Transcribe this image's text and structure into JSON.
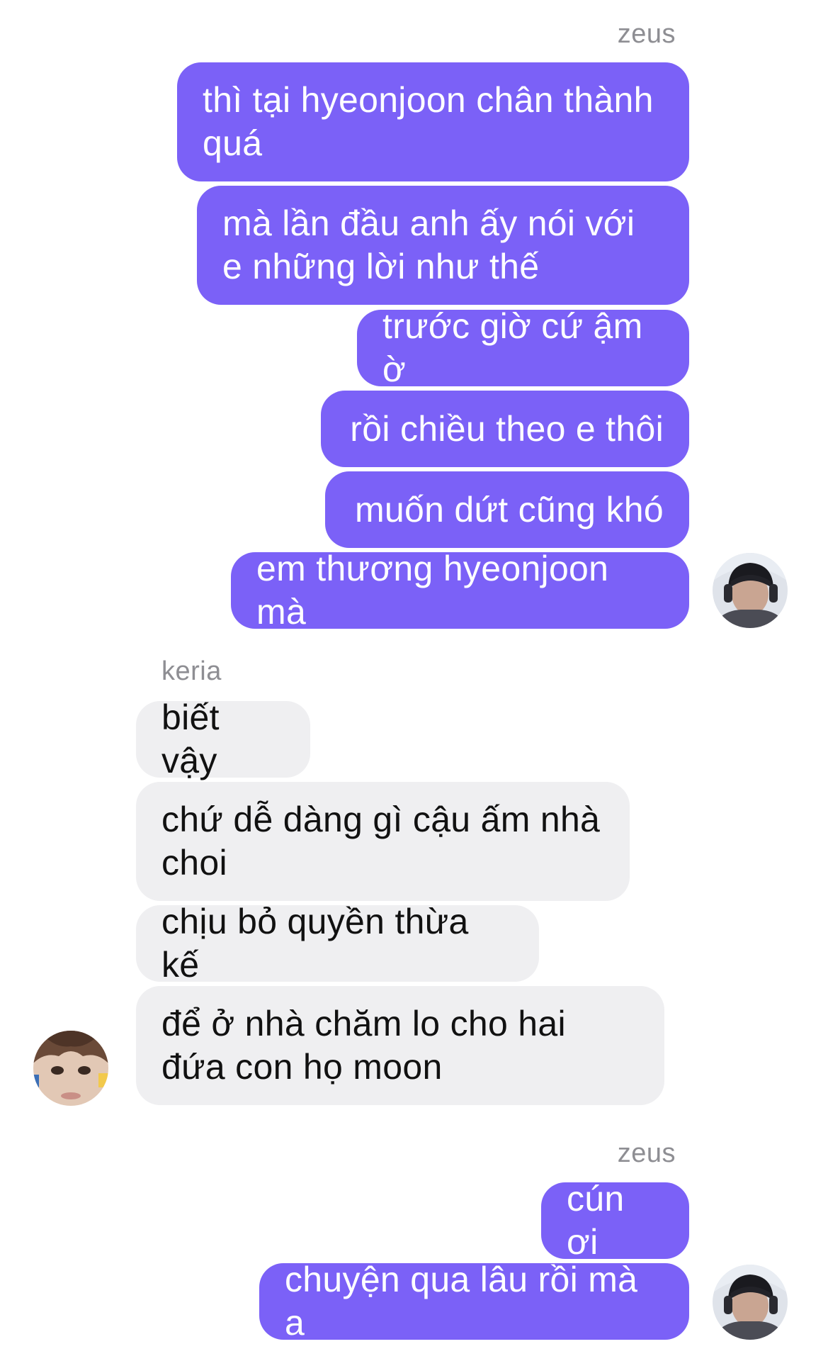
{
  "chat": {
    "group1": {
      "sender": "zeus",
      "messages": [
        "thì tại hyeonjoon chân thành quá",
        "mà lần đầu anh ấy nói với e những lời như thế",
        "trước giờ cứ ậm ờ",
        "rồi chiều theo e thôi",
        "muốn dứt cũng khó",
        "em thương hyeonjoon mà"
      ]
    },
    "group2": {
      "sender": "keria",
      "messages": [
        "biết vậy",
        "chứ dễ dàng gì cậu ấm nhà choi",
        "chịu bỏ quyền thừa kế",
        "để ở nhà chăm lo cho hai đứa con họ moon"
      ]
    },
    "group3": {
      "sender": "zeus",
      "messages": [
        "cún ơi",
        "chuyện qua lâu rồi mà a"
      ]
    }
  },
  "colors": {
    "outgoing_bubble": "#7b61f7",
    "incoming_bubble": "#efeff1",
    "sender_name": "#8e8e93"
  },
  "icons": {
    "zeus_avatar": "user-avatar-zeus",
    "keria_avatar": "user-avatar-keria"
  }
}
